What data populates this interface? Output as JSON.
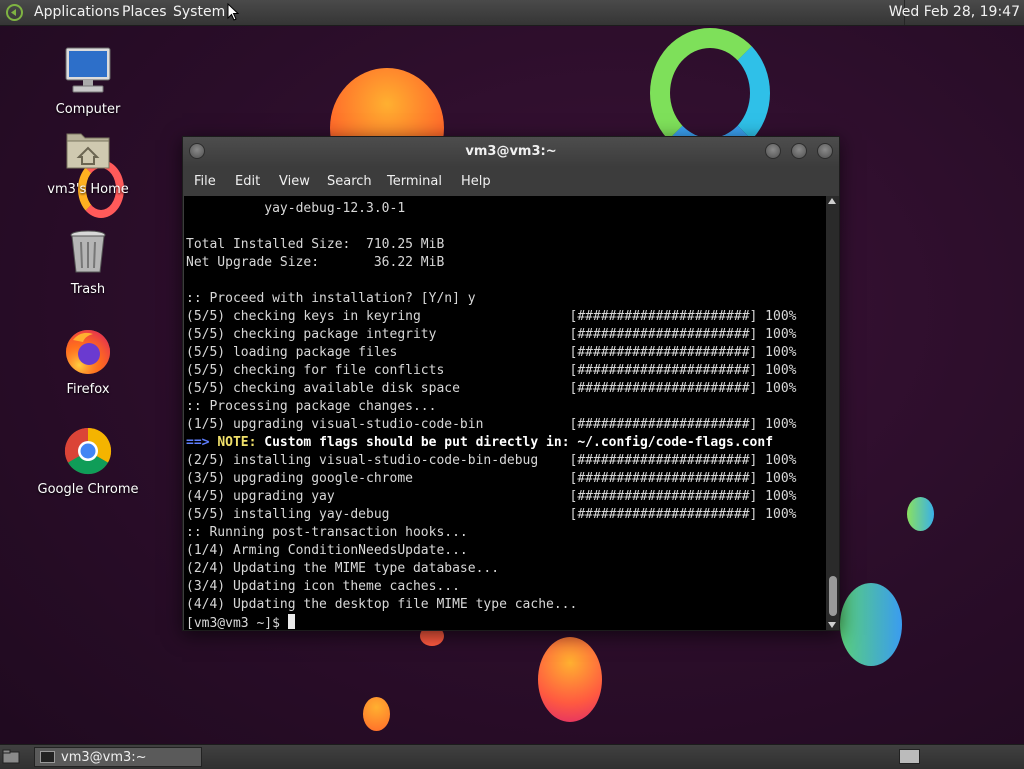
{
  "top_panel": {
    "menus": [
      "Applications",
      "Places",
      "System"
    ],
    "clock": "Wed Feb 28, 19:47"
  },
  "desktop_icons": [
    {
      "label": "Computer",
      "icon": "computer-icon"
    },
    {
      "label": "vm3's Home",
      "icon": "home-folder-icon"
    },
    {
      "label": "Trash",
      "icon": "trash-icon"
    },
    {
      "label": "Firefox",
      "icon": "firefox-icon"
    },
    {
      "label": "Google Chrome",
      "icon": "chrome-icon"
    }
  ],
  "terminal": {
    "title": "vm3@vm3:~",
    "menu": [
      "File",
      "Edit",
      "View",
      "Search",
      "Terminal",
      "Help"
    ],
    "lines": [
      "          yay-debug-12.3.0-1",
      "",
      "Total Installed Size:  710.25 MiB",
      "Net Upgrade Size:       36.22 MiB",
      "",
      ":: Proceed with installation? [Y/n] y",
      "(5/5) checking keys in keyring                   [######################] 100%",
      "(5/5) checking package integrity                 [######################] 100%",
      "(5/5) loading package files                      [######################] 100%",
      "(5/5) checking for file conflicts                [######################] 100%",
      "(5/5) checking available disk space              [######################] 100%",
      ":: Processing package changes...",
      "(1/5) upgrading visual-studio-code-bin           [######################] 100%",
      "",
      "(2/5) installing visual-studio-code-bin-debug    [######################] 100%",
      "(3/5) upgrading google-chrome                    [######################] 100%",
      "(4/5) upgrading yay                              [######################] 100%",
      "(5/5) installing yay-debug                       [######################] 100%",
      ":: Running post-transaction hooks...",
      "(1/4) Arming ConditionNeedsUpdate...",
      "(2/4) Updating the MIME type database...",
      "(3/4) Updating icon theme caches...",
      "(4/4) Updating the desktop file MIME type cache..."
    ],
    "note_arrow": "==>",
    "note_label": "NOTE:",
    "note_text": "Custom flags should be put directly in: ~/.config/code-flags.conf",
    "prompt": "[vm3@vm3 ~]$ "
  },
  "taskbar": {
    "window_button": "vm3@vm3:~"
  },
  "colors": {
    "background": "#2a0d29",
    "panel": "#3c3c3c",
    "note_arrow": "#5f7fff",
    "note_label": "#f0e06a"
  }
}
